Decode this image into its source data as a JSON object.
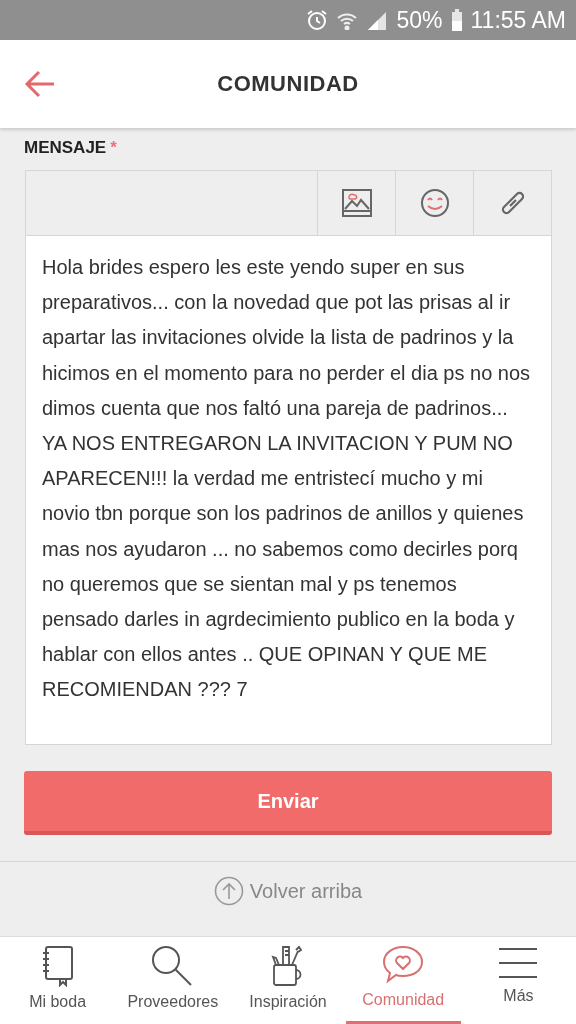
{
  "status_bar": {
    "battery": "50%",
    "time": "11:55 AM"
  },
  "header": {
    "title": "COMUNIDAD"
  },
  "form": {
    "label": "MENSAJE",
    "required_mark": "*",
    "message": "Hola brides espero les este yendo super en sus preparativos... con la novedad que pot las prisas al ir apartar las invitaciones olvide la lista de padrinos y la hicimos en el momento para no perder el dia ps no nos dimos cuenta que nos faltó una pareja de padrinos... YA NOS ENTREGARON LA INVITACION Y PUM NO APARECEN!!! la verdad me entristecí mucho y mi novio tbn porque son los padrinos de anillos y quienes mas nos ayudaron ... no sabemos como decirles porq no queremos que se sientan mal y ps tenemos pensado darles in agrdecimiento publico en la boda y hablar con ellos antes .. QUE OPINAN Y QUE ME RECOMIENDAN ??? 7",
    "submit": "Enviar"
  },
  "back_to_top": "Volver arriba",
  "nav": [
    {
      "kind": "notebook",
      "label": "Mi boda",
      "selected": false
    },
    {
      "kind": "search",
      "label": "Proveedores",
      "selected": false
    },
    {
      "kind": "mug",
      "label": "Inspiración",
      "selected": false
    },
    {
      "kind": "chat",
      "label": "Comunidad",
      "selected": true
    },
    {
      "kind": "menu",
      "label": "Más",
      "selected": false
    }
  ]
}
